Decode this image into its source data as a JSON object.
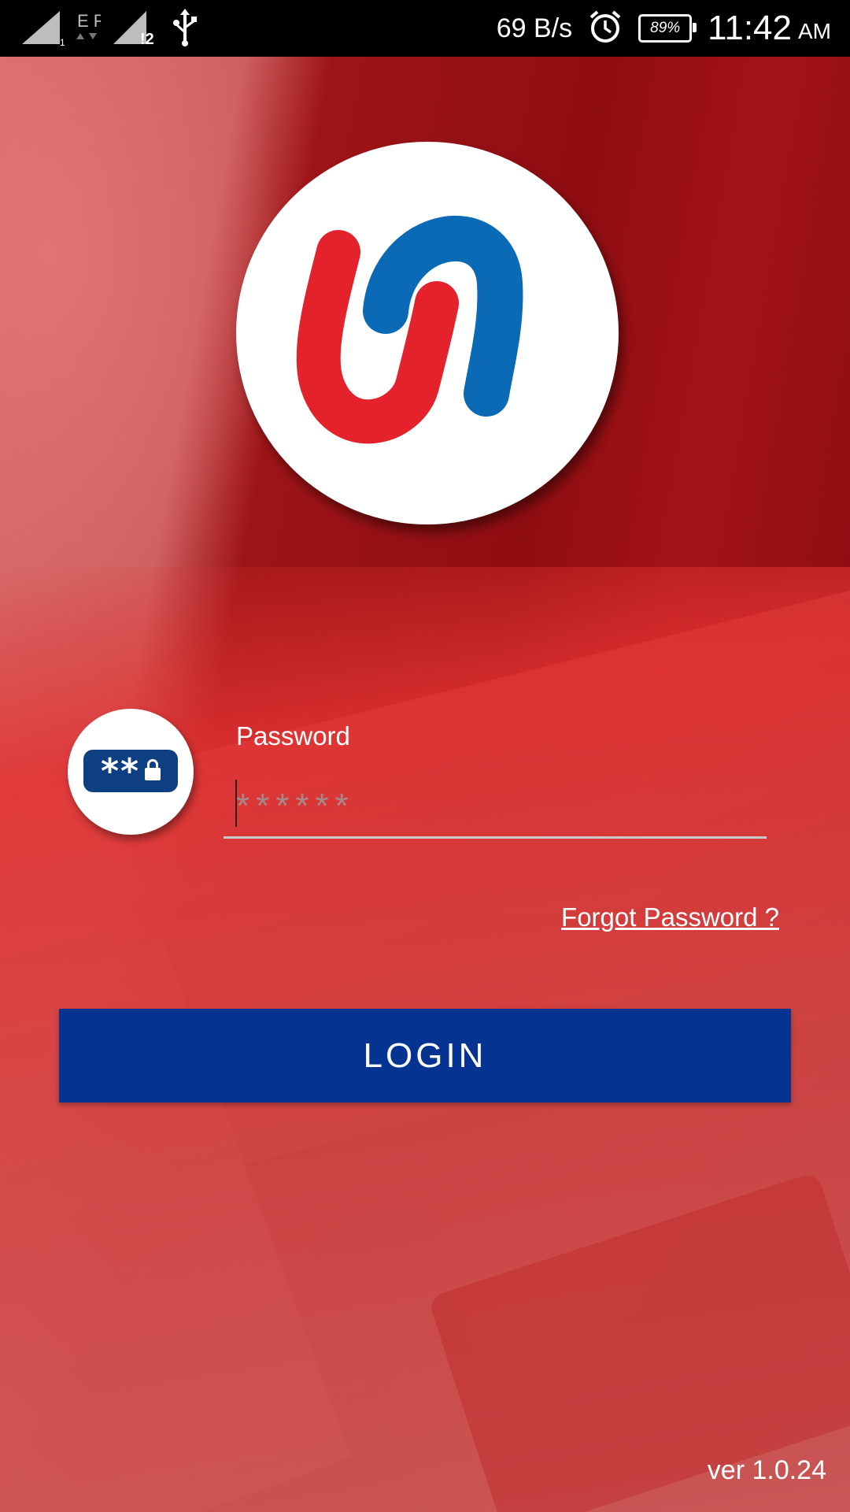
{
  "status_bar": {
    "sim1_label": "1",
    "network_label": "E R",
    "sim2_label": "!2",
    "speed": "69 B/s",
    "battery": "89%",
    "time": "11:42",
    "ampm": "AM",
    "icons": [
      "signal-icon",
      "data-arrows-icon",
      "signal-icon",
      "usb-icon",
      "alarm-icon",
      "battery-icon"
    ]
  },
  "logo": {
    "icon": "union-bank-logo-icon",
    "colors": {
      "red": "#e3222b",
      "blue": "#0a6ab6"
    }
  },
  "login": {
    "password_label": "Password",
    "password_placeholder": "******",
    "password_icon": "password-lock-icon",
    "forgot_password": "Forgot Password ?",
    "login_button": "LOGIN"
  },
  "footer": {
    "version": "ver 1.0.24"
  },
  "colors": {
    "button": "#053391",
    "background": "#c8191d"
  }
}
